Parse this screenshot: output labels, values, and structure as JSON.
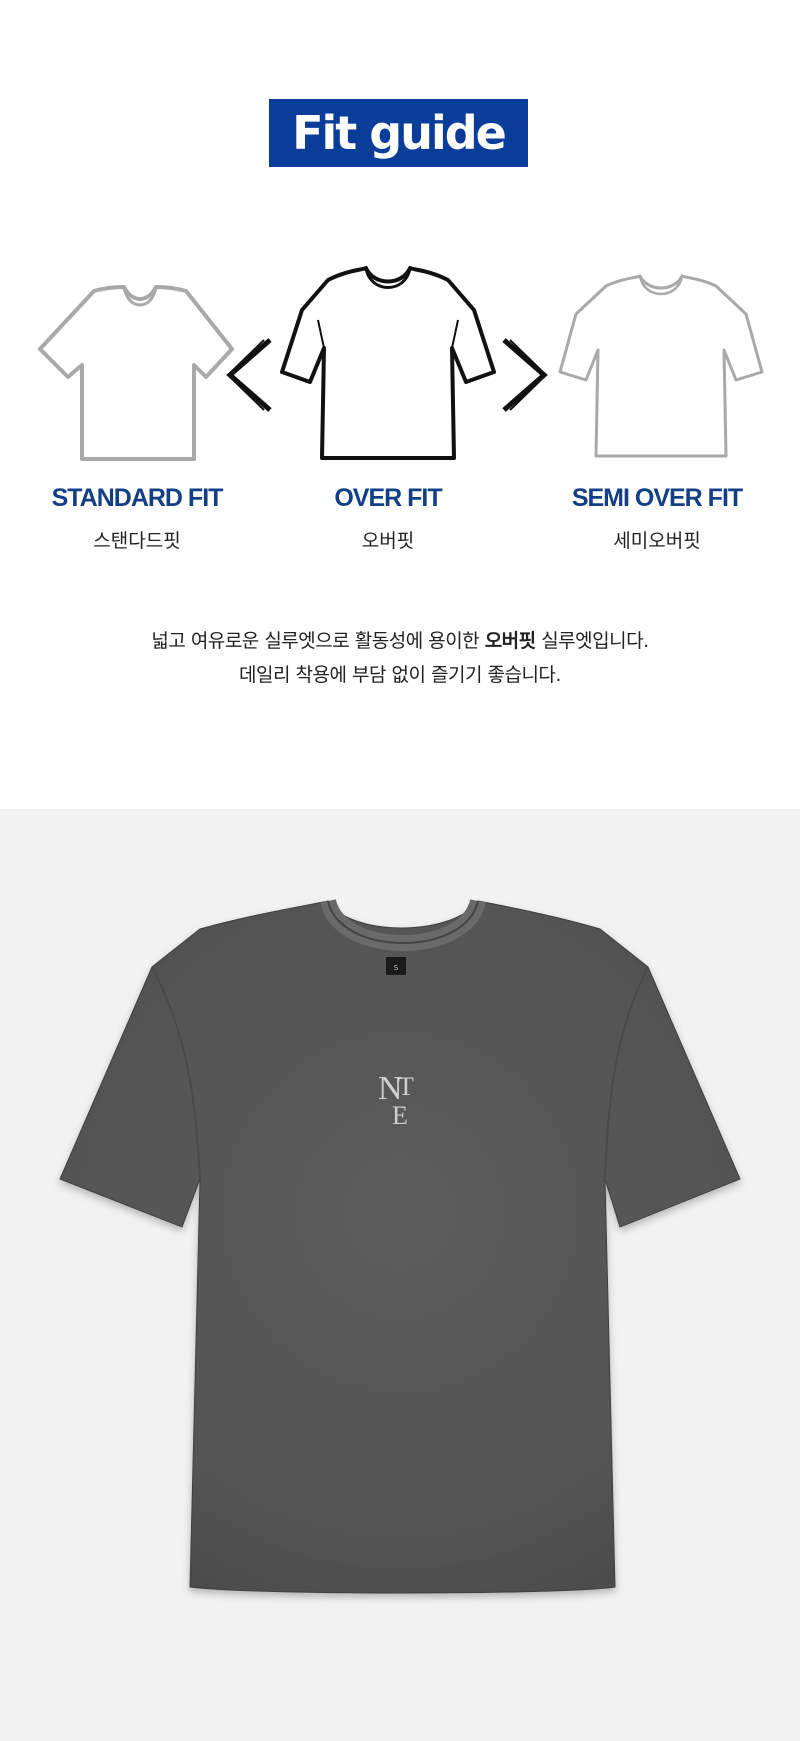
{
  "header": {
    "title": "Fit guide"
  },
  "fits": [
    {
      "en": "STANDARD FIT",
      "ko": "스탠다드핏"
    },
    {
      "en": "OVER FIT",
      "ko": "오버핏"
    },
    {
      "en": "SEMI OVER FIT",
      "ko": "세미오버핏"
    }
  ],
  "description": {
    "line1_before": "넓고 여유로운 실루엣으로 활동성에 용이한 ",
    "line1_bold": "오버핏",
    "line1_after": " 실루엣입니다.",
    "line2": "데일리 착용에 부담 없이 즐기기 좋습니다."
  },
  "product": {
    "neck_tag": "S",
    "logo_text": "NTE",
    "color": "#575757"
  },
  "colors": {
    "accent": "#0a3d99",
    "label": "#123f86"
  }
}
